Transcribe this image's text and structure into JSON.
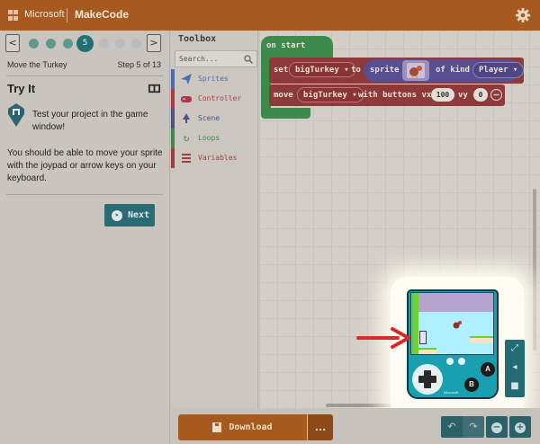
{
  "header": {
    "brand": "Microsoft",
    "product": "MakeCode"
  },
  "tutorial": {
    "current_step_badge": "5",
    "step_title": "Move the Turkey",
    "step_count": "Step 5 of 13",
    "heading": "Try It",
    "instruction_1": "Test your project in the game window!",
    "instruction_2": "You should be able to move your sprite with the joypad or arrow keys on your keyboard.",
    "next_label": "Next",
    "prev_arrow": "<",
    "next_arrow": ">"
  },
  "toolbox": {
    "title": "Toolbox",
    "search_placeholder": "Search...",
    "categories": [
      {
        "label": "Sprites",
        "color": "#4b6cb0",
        "icon": "paper-plane-icon"
      },
      {
        "label": "Controller",
        "color": "#b0384a",
        "icon": "gamepad-icon"
      },
      {
        "label": "Scene",
        "color": "#4b5380",
        "icon": "tree-icon"
      },
      {
        "label": "Loops",
        "color": "#3d8a4c",
        "icon": "refresh-icon"
      },
      {
        "label": "Variables",
        "color": "#a33d3d",
        "icon": "list-icon"
      }
    ]
  },
  "blocks": {
    "on_start": "on start",
    "set": "set",
    "variable": "bigTurkey",
    "to": "to",
    "sprite": "sprite",
    "of_kind": "of kind",
    "kind": "Player",
    "move": "move",
    "with_buttons": "with buttons vx",
    "vx": "100",
    "vy_label": "vy",
    "vy": "0"
  },
  "simulator": {
    "button_a": "A",
    "button_b": "B",
    "logo": "Microsoft"
  },
  "footer": {
    "download_label": "Download",
    "more_label": "..."
  },
  "colors": {
    "header": "#a65a1f",
    "accent_teal": "#2a6c73",
    "highlight_arrow": "#d62b2b"
  }
}
